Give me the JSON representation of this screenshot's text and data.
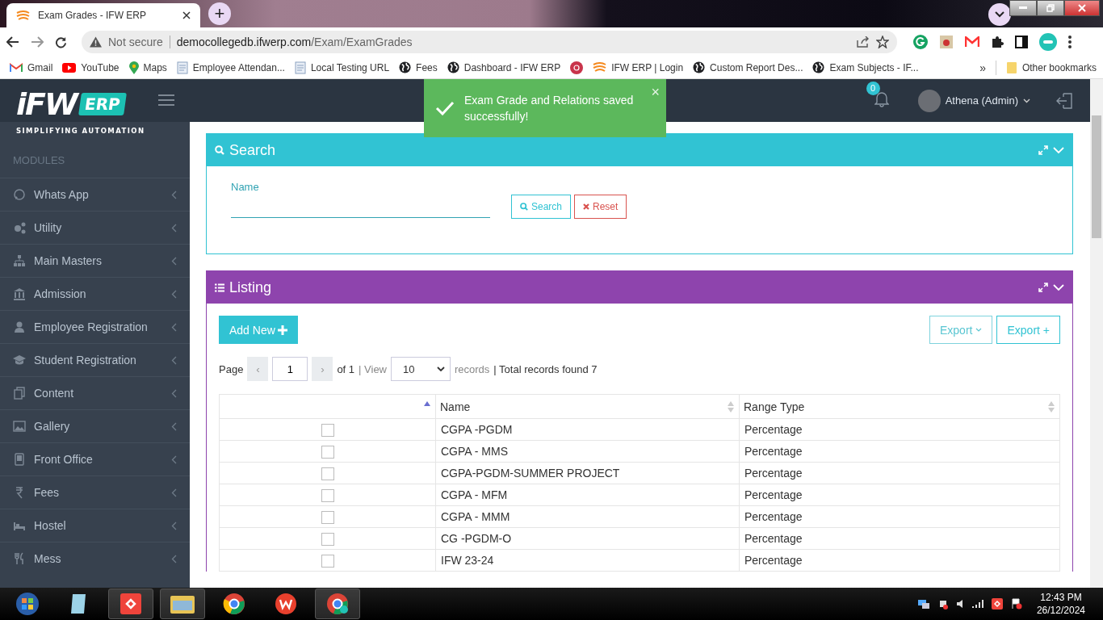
{
  "browser": {
    "tabs": [
      {
        "title": "Exam Grades - IFW ERP",
        "selected": true
      }
    ],
    "new_tab": "+",
    "address": {
      "security": "Not secure",
      "host": "democollegedb.ifwerp.com",
      "path": "/Exam/ExamGrades"
    },
    "bookmarks": [
      {
        "label": "Gmail",
        "kind": "gmail"
      },
      {
        "label": "YouTube",
        "kind": "youtube"
      },
      {
        "label": "Maps",
        "kind": "maps"
      },
      {
        "label": "Employee Attendan...",
        "kind": "page"
      },
      {
        "label": "Local Testing URL",
        "kind": "page"
      },
      {
        "label": "Fees",
        "kind": "globe"
      },
      {
        "label": "Dashboard - IFW ERP",
        "kind": "globe"
      },
      {
        "kind": "dot"
      },
      {
        "label": "IFW ERP | Login",
        "kind": "ifw"
      },
      {
        "label": "Custom Report Des...",
        "kind": "globe"
      },
      {
        "label": "Exam Subjects - IF...",
        "kind": "globe"
      }
    ],
    "more_bookmarks": "»",
    "other_bookmarks": "Other bookmarks"
  },
  "header": {
    "notifications": "0",
    "user": "Athena (Admin)"
  },
  "logo": {
    "text": "iFW",
    "badge": "ERP",
    "tagline": "SIMPLIFYING AUTOMATION"
  },
  "sidebar": {
    "section": "MODULES",
    "items": [
      {
        "label": "Whats App"
      },
      {
        "label": "Utility"
      },
      {
        "label": "Main Masters"
      },
      {
        "label": "Admission"
      },
      {
        "label": "Employee Registration"
      },
      {
        "label": "Student Registration"
      },
      {
        "label": "Content"
      },
      {
        "label": "Gallery"
      },
      {
        "label": "Front Office"
      },
      {
        "label": "Fees"
      },
      {
        "label": "Hostel"
      },
      {
        "label": "Mess"
      }
    ]
  },
  "toast": {
    "message": "Exam Grade and Relations saved successfully!",
    "close": "×"
  },
  "search_panel": {
    "title": "Search",
    "field": {
      "label": "Name"
    },
    "buttons": [
      {
        "label": "Search",
        "kind": "search"
      },
      {
        "label": "Reset",
        "kind": "reset"
      }
    ]
  },
  "listing": {
    "title": "Listing",
    "add_button": "Add New",
    "export_buttons": [
      {
        "label": "Export",
        "kind": "dropdown"
      },
      {
        "label": "Export +",
        "kind": "plain"
      }
    ],
    "pagination": {
      "label": "Page",
      "prev": "‹",
      "page": "1",
      "next": "›",
      "of": "of 1",
      "view": "| View",
      "per_page": "10",
      "records": "records",
      "total": "| Total records found 7"
    },
    "table": {
      "columns": [
        {
          "sorted": true
        },
        {
          "label": "Name",
          "sorted": false
        },
        {
          "label": "Range Type",
          "sorted": false
        }
      ],
      "rows": [
        {
          "checked": false,
          "name": "CGPA -PGDM",
          "range_type": "Percentage"
        },
        {
          "checked": false,
          "name": "CGPA - MMS",
          "range_type": "Percentage"
        },
        {
          "checked": false,
          "name": "CGPA-PGDM-SUMMER PROJECT",
          "range_type": "Percentage"
        },
        {
          "checked": false,
          "name": "CGPA - MFM",
          "range_type": "Percentage"
        },
        {
          "checked": false,
          "name": "CGPA - MMM",
          "range_type": "Percentage"
        },
        {
          "checked": false,
          "name": "CG -PGDM-O",
          "range_type": "Percentage"
        },
        {
          "checked": false,
          "name": "IFW 23-24",
          "range_type": "Percentage"
        }
      ]
    }
  },
  "taskbar": {
    "time": "12:43 PM",
    "date": "26/12/2024"
  }
}
